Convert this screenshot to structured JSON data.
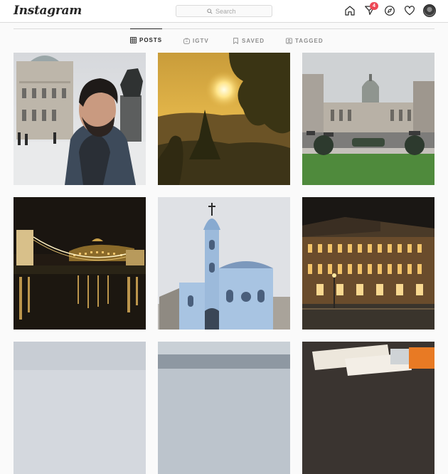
{
  "header": {
    "logo_text": "Instagram",
    "search": {
      "placeholder": "Search"
    },
    "activity_badge_count": "4",
    "icons": [
      "home-icon",
      "direct-message-icon",
      "explore-compass-icon",
      "heart-icon"
    ]
  },
  "profile_tabs": [
    {
      "label": "POSTS",
      "icon": "grid-icon",
      "active": true
    },
    {
      "label": "IGTV",
      "icon": "igtv-icon",
      "active": false
    },
    {
      "label": "SAVED",
      "icon": "bookmark-icon",
      "active": false
    },
    {
      "label": "TAGGED",
      "icon": "tagged-portrait-icon",
      "active": false
    }
  ],
  "posts": [
    {
      "subject": "man in hoodie by museum and statue",
      "row": 1,
      "col": 1
    },
    {
      "subject": "golden sunset through trees",
      "row": 1,
      "col": 2
    },
    {
      "subject": "national museum plaza with lawn",
      "row": 1,
      "col": 3
    },
    {
      "subject": "chain bridge and castle at night",
      "row": 2,
      "col": 1
    },
    {
      "subject": "blue church with tower",
      "row": 2,
      "col": 2
    },
    {
      "subject": "opera house at night",
      "row": 2,
      "col": 3
    },
    {
      "subject": "pale sky landscape",
      "row": 3,
      "col": 1
    },
    {
      "subject": "city skyline haze",
      "row": 3,
      "col": 2
    },
    {
      "subject": "tickets on table",
      "row": 3,
      "col": 3
    }
  ],
  "colors": {
    "accent_text": "#262626",
    "muted_text": "#8e8e8e",
    "border": "#dbdbdb",
    "badge": "#ed4956",
    "page_bg": "#fafafa"
  }
}
